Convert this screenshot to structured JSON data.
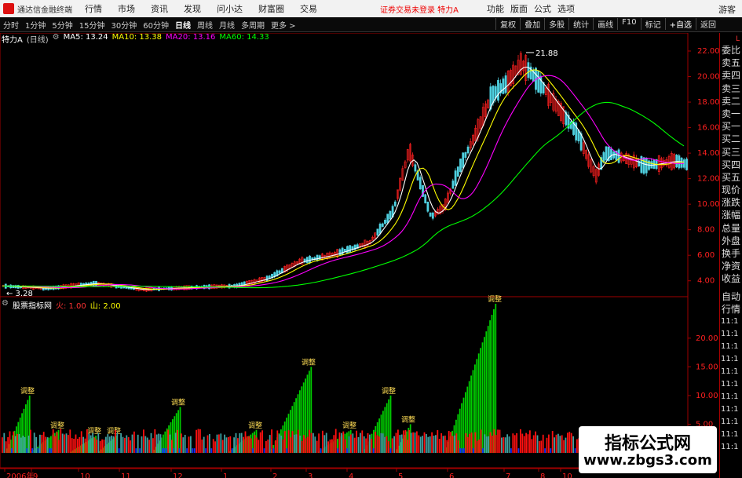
{
  "app": {
    "name": "通达信金融终端",
    "warning": "证券交易未登录 特力A",
    "guest": "游客"
  },
  "menu": [
    "行情",
    "市场",
    "资讯",
    "发现",
    "问小达",
    "财富圈",
    "交易"
  ],
  "menu_right": [
    "功能",
    "版面",
    "公式",
    "选项"
  ],
  "periods": [
    "分时",
    "1分钟",
    "5分钟",
    "15分钟",
    "30分钟",
    "60分钟",
    "日线",
    "周线",
    "月线",
    "多周期"
  ],
  "more_label": "更多 >",
  "toolbar_right": [
    "复权",
    "叠加",
    "多股",
    "统计",
    "画线",
    "F10",
    "标记",
    "+自选",
    "返回"
  ],
  "main_legend": {
    "title": "特力A",
    "period": "(日线)",
    "ma5": "MA5: 13.24",
    "ma10": "MA10: 13.38",
    "ma20": "MA20: 13.16",
    "ma60": "MA60: 14.33"
  },
  "sub_legend": {
    "name": "股票指标网",
    "fire": "火: 1.00",
    "mountain": "山: 2.00"
  },
  "sidebar": [
    "委比",
    "卖五",
    "卖四",
    "卖三",
    "卖二",
    "卖一",
    "买一",
    "买二",
    "买三",
    "买四",
    "买五",
    "现价",
    "涨跌",
    "涨幅",
    "总量",
    "外盘",
    "换手",
    "净资",
    "收益",
    "自动",
    "行情"
  ],
  "sidebar_corner": "L",
  "times": [
    "11:1",
    "11:1",
    "11:1",
    "11:1",
    "11:1",
    "11:1",
    "11:1",
    "11:1",
    "11:1",
    "11:1",
    "11:1"
  ],
  "price_axis": [
    "22.00",
    "20.00",
    "18.00",
    "16.00",
    "14.00",
    "12.00",
    "10.00",
    "8.00",
    "6.00",
    "4.00"
  ],
  "ind_axis": [
    "20.00",
    "15.00",
    "10.00",
    "5.00"
  ],
  "x_axis": [
    "2006年",
    "9",
    "10",
    "11",
    "12",
    "1",
    "2",
    "3",
    "4",
    "5",
    "6",
    "7",
    "8",
    "10"
  ],
  "annotations": {
    "high": "21.88",
    "low": "3.28",
    "tag": "调整"
  },
  "watermark": {
    "line1": "指标公式网",
    "line2": "www.zbgs3.com"
  },
  "colors": {
    "bg": "#000000",
    "up": "#ff2020",
    "axis": "#a00000",
    "ma5": "#ffffff",
    "ma10": "#ffff00",
    "ma20": "#ff00ff",
    "ma60": "#00ff00",
    "bar_green": "#00cc00",
    "bar_red": "#ff1010",
    "bar_cyan": "#40a0a0",
    "bar_blue": "#1030ff"
  }
}
